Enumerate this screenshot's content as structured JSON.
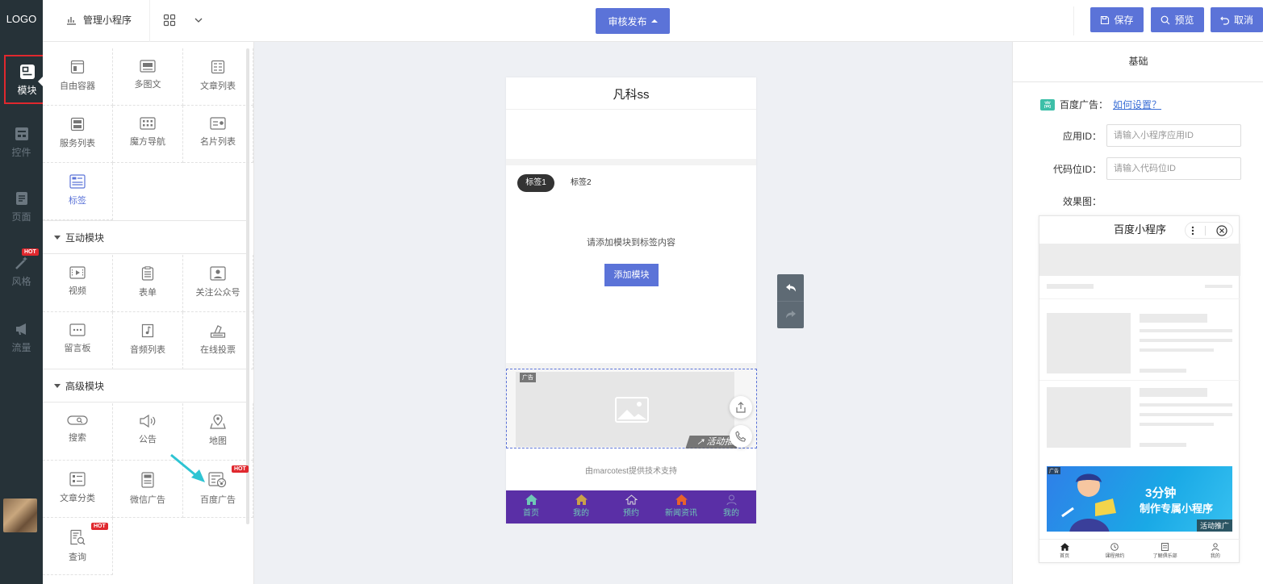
{
  "topbar": {
    "logo": "LOGO",
    "app_name": "管理小程序",
    "publish_label": "审核发布",
    "save_label": "保存",
    "preview_label": "预览",
    "cancel_label": "取消"
  },
  "leftnav": {
    "items": [
      {
        "label": "模块",
        "icon": "module-icon",
        "active": true
      },
      {
        "label": "控件",
        "icon": "widget-icon"
      },
      {
        "label": "页面",
        "icon": "page-icon"
      },
      {
        "label": "风格",
        "icon": "magic-wand-icon",
        "badge": "HOT"
      },
      {
        "label": "流量",
        "icon": "megaphone-icon"
      }
    ]
  },
  "modules": {
    "basic": [
      {
        "label": "自由容器",
        "icon": "container-icon"
      },
      {
        "label": "多图文",
        "icon": "image-text-icon"
      },
      {
        "label": "文章列表",
        "icon": "article-list-icon"
      },
      {
        "label": "服务列表",
        "icon": "service-list-icon"
      },
      {
        "label": "魔方导航",
        "icon": "cube-nav-icon"
      },
      {
        "label": "名片列表",
        "icon": "card-list-icon"
      },
      {
        "label": "标签",
        "icon": "tab-icon",
        "active": true
      }
    ],
    "interactive_title": "互动模块",
    "interactive": [
      {
        "label": "视频",
        "icon": "video-icon"
      },
      {
        "label": "表单",
        "icon": "form-icon"
      },
      {
        "label": "关注公众号",
        "icon": "follow-account-icon"
      },
      {
        "label": "留言板",
        "icon": "message-board-icon"
      },
      {
        "label": "音频列表",
        "icon": "audio-list-icon"
      },
      {
        "label": "在线投票",
        "icon": "vote-icon"
      }
    ],
    "advanced_title": "高级模块",
    "advanced": [
      {
        "label": "搜索",
        "icon": "search-icon"
      },
      {
        "label": "公告",
        "icon": "announcement-icon"
      },
      {
        "label": "地图",
        "icon": "map-pin-icon"
      },
      {
        "label": "文章分类",
        "icon": "article-category-icon"
      },
      {
        "label": "微信广告",
        "icon": "wechat-ad-icon"
      },
      {
        "label": "百度广告",
        "icon": "baidu-ad-icon",
        "badge": "HOT"
      },
      {
        "label": "查询",
        "icon": "query-icon",
        "badge": "HOT"
      }
    ]
  },
  "phone": {
    "title": "凡科ss",
    "tabs": [
      "标签1",
      "标签2"
    ],
    "tab_hint": "请添加模块到标签内容",
    "add_module": "添加模块",
    "ad_tag": "广告",
    "ad_promo": "活动推",
    "powered_by": "由marcotest提供技术支持",
    "tabbar": [
      "首页",
      "我的",
      "预约",
      "新闻资讯",
      "我的"
    ]
  },
  "right_panel": {
    "title": "基础",
    "baidu_ad_label": "百度广告：",
    "baidu_ad_badge": "高",
    "baidu_ad_link": "如何设置？",
    "app_id_label": "应用ID：",
    "app_id_placeholder": "请输入小程序应用ID",
    "slot_id_label": "代码位ID：",
    "slot_id_placeholder": "请输入代码位ID",
    "effect_label": "效果图：",
    "effect": {
      "title": "百度小程序",
      "banner_line1": "3分钟",
      "banner_line2": "制作专属小程序",
      "banner_promo": "活动推广",
      "banner_tag": "广告",
      "tabbar": [
        "首页",
        "课程预约",
        "了解俱乐部",
        "我的"
      ]
    }
  },
  "colors": {
    "primary": "#5b73d8",
    "sidebar": "#263238",
    "tabbar": "#5a2fa6",
    "hot": "#e0282e"
  }
}
